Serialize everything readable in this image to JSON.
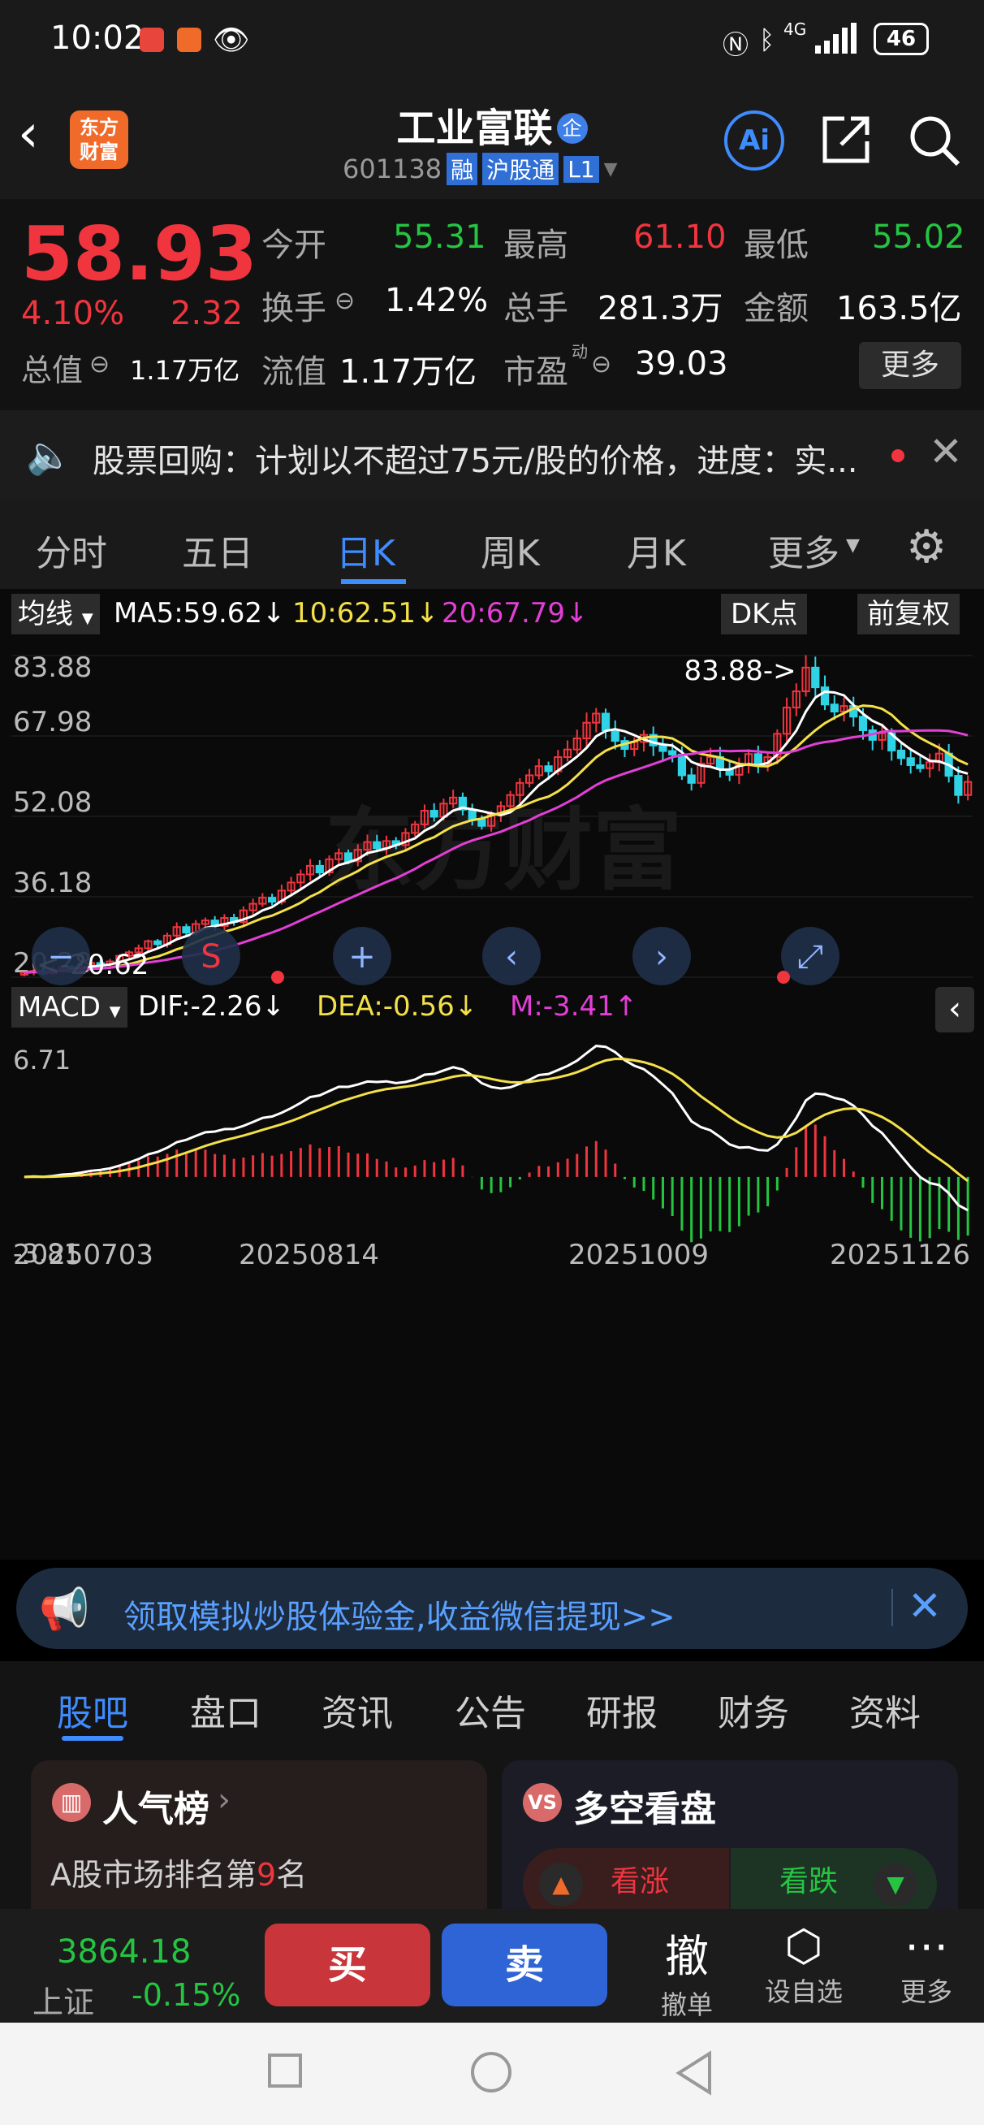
{
  "status": {
    "time": "10:02",
    "battery": "46",
    "network": "4G"
  },
  "header": {
    "title": "工业富联",
    "badge_qi": "企",
    "code": "601138",
    "tag_rong": "融",
    "tag_hgt": "沪股通",
    "tag_l1": "L1",
    "logo_line1": "东方",
    "logo_line2": "财富",
    "ai_label": "Ai"
  },
  "quote": {
    "price": "58.93",
    "pct": "4.10%",
    "change": "2.32",
    "open_label": "今开",
    "open": "55.31",
    "high_label": "最高",
    "high": "61.10",
    "low_label": "最低",
    "low": "55.02",
    "turnover_label": "换手",
    "turnover": "1.42%",
    "volume_label": "总手",
    "volume": "281.3万",
    "amount_label": "金额",
    "amount": "163.5亿",
    "mcap_label": "总值",
    "mcap": "1.17万亿",
    "float_label": "流值",
    "float": "1.17万亿",
    "pe_label": "市盈",
    "pe_sup": "动",
    "pe": "39.03",
    "more": "更多"
  },
  "notice": {
    "text": "股票回购：计划以不超过75元/股的价格，进度：实..."
  },
  "period_tabs": [
    "分时",
    "五日",
    "日K",
    "周K",
    "月K",
    "更多"
  ],
  "active_tab": 2,
  "chart_data": [
    {
      "type": "candlestick",
      "indicator_label": "均线",
      "ma5": "MA5:59.62↓",
      "ma10": "10:62.51↓",
      "ma20": "20:67.79↓",
      "dk_label": "DK点",
      "adjust_label": "前复权",
      "y_ticks": [
        "83.88",
        "67.98",
        "52.08",
        "36.18",
        "20.28"
      ],
      "max_label": "83.88->",
      "min_label": "<-20.62",
      "x_ticks": [
        "20250703",
        "20250814",
        "20251009",
        "20251126"
      ],
      "watermark": "东方财富",
      "close": [
        21.2,
        21.5,
        21.0,
        21.8,
        22.3,
        22.0,
        22.6,
        23.1,
        22.8,
        23.4,
        24.5,
        25.2,
        26.0,
        27.4,
        26.8,
        28.5,
        30.2,
        29.1,
        30.8,
        31.5,
        30.4,
        32.0,
        31.2,
        33.5,
        34.8,
        36.0,
        35.2,
        37.4,
        39.0,
        40.6,
        42.3,
        41.0,
        43.6,
        44.8,
        43.2,
        45.5,
        47.0,
        45.8,
        47.2,
        46.4,
        48.8,
        50.5,
        53.2,
        52.0,
        54.6,
        55.8,
        53.4,
        51.5,
        50.2,
        52.4,
        54.1,
        56.3,
        58.7,
        60.2,
        62.0,
        61.0,
        63.8,
        65.3,
        67.5,
        70.6,
        72.4,
        69.1,
        67.0,
        65.4,
        66.8,
        68.2,
        66.1,
        65.0,
        64.3,
        60.2,
        58.7,
        62.5,
        63.8,
        61.4,
        60.3,
        62.2,
        64.4,
        62.5,
        63.8,
        68.4,
        73.6,
        76.8,
        81.5,
        77.6,
        74.2,
        72.8,
        73.9,
        71.8,
        69.1,
        67.2,
        68.5,
        65.1,
        63.6,
        62.2,
        61.6,
        62.8,
        64.5,
        60.1,
        56.3,
        58.9
      ]
    },
    {
      "type": "macd",
      "indicator_label": "MACD",
      "dif": "DIF:-2.26↓",
      "dea": "DEA:-0.56↓",
      "m": "M:-3.41↑",
      "y_ticks": [
        "6.71",
        "-3.81"
      ],
      "ylim": [
        -3.81,
        6.71
      ]
    }
  ],
  "promo": {
    "text": "领取模拟炒股体验金,收益微信提现>>"
  },
  "content_tabs": [
    "股吧",
    "盘口",
    "资讯",
    "公告",
    "研报",
    "财务",
    "资料"
  ],
  "active_content_tab": 0,
  "cards": {
    "popularity_title": "人气榜",
    "popularity_pre": "A股市场排名第",
    "popularity_rank": "9",
    "popularity_post": "名",
    "sentiment_title": "多空看盘",
    "bull": "看涨",
    "bear": "看跌"
  },
  "bottom": {
    "index_value": "3864.18",
    "index_name": "上证",
    "index_pct": "-0.15%",
    "buy": "买",
    "sell": "卖",
    "cancel_glyph": "撤",
    "cancel": "撤单",
    "watch": "设自选",
    "more": "更多"
  },
  "colors": {
    "up": "#f0353f",
    "down": "#25c542",
    "ma5": "#ffffff",
    "ma10": "#f3e04a",
    "ma20": "#e33fd6",
    "accent": "#3f8cff"
  }
}
